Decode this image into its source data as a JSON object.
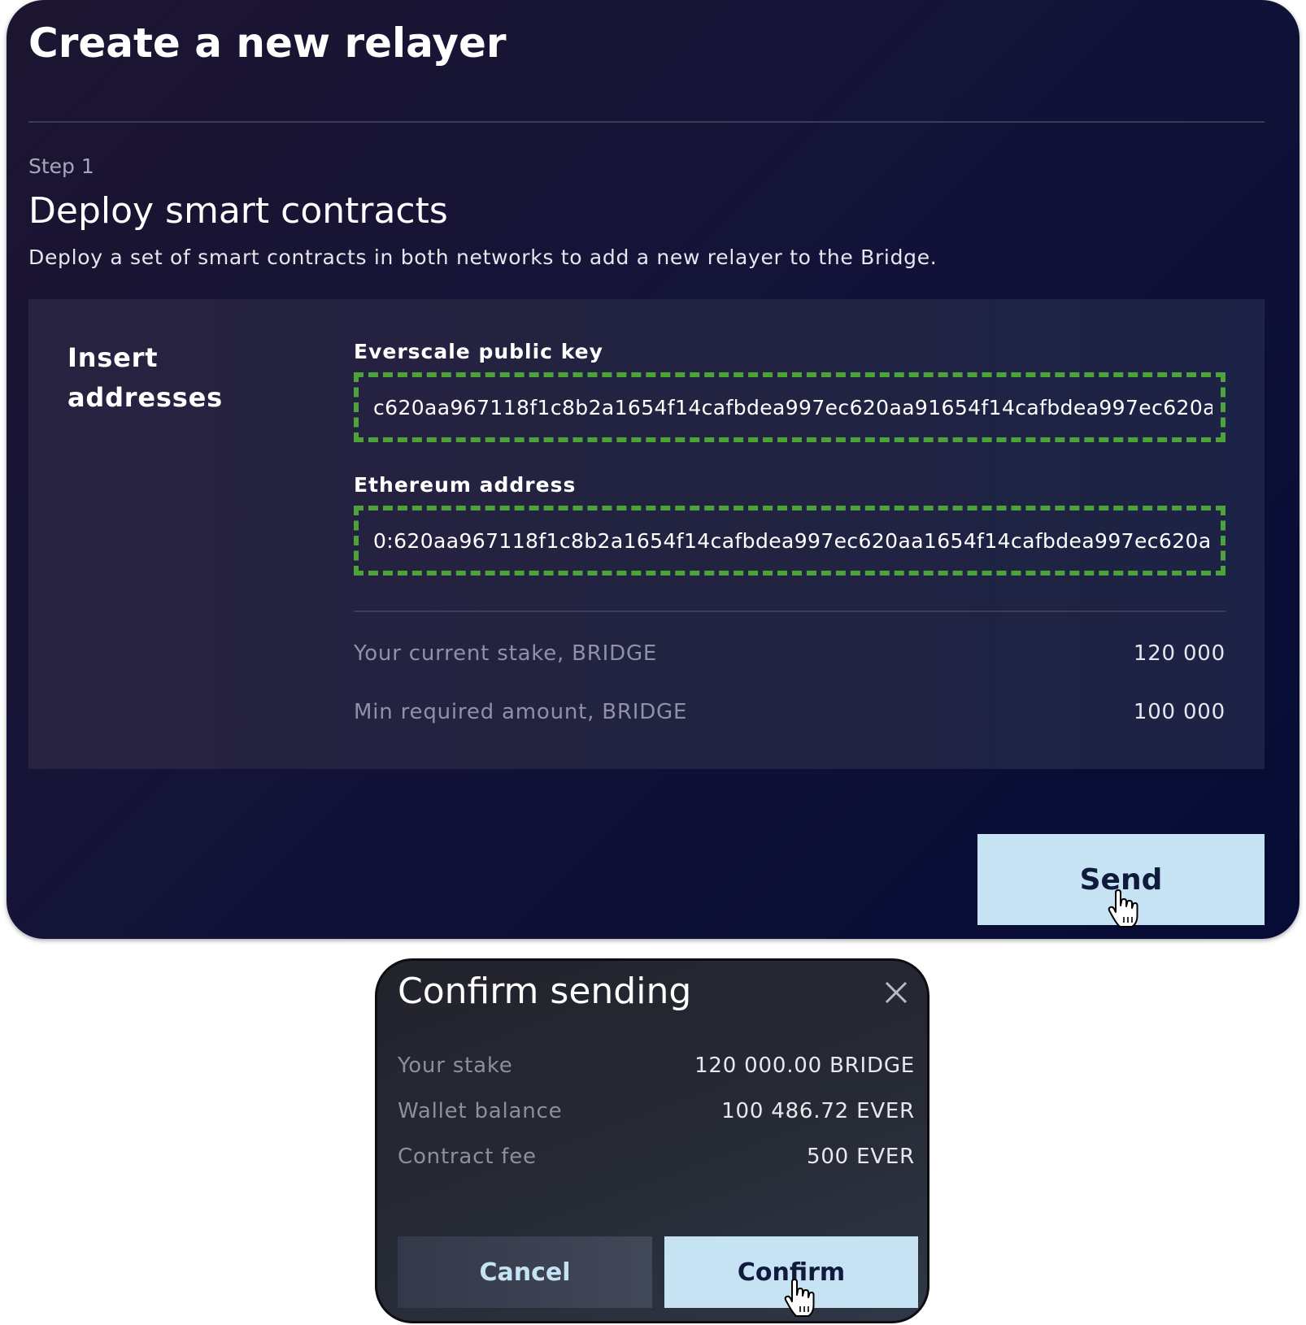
{
  "card": {
    "title": "Create a new relayer",
    "step": "Step 1",
    "subtitle": "Deploy smart contracts",
    "description": "Deploy a set of smart contracts in both networks to add a new relayer to the Bridge.",
    "panel": {
      "label": "Insert addresses",
      "everscale": {
        "label": "Everscale public key",
        "value": "c620aa967118f1c8b2a1654f14cafbdea997ec620aa91654f14cafbdea997ec620a"
      },
      "ethereum": {
        "label": "Ethereum address",
        "value": "0:620aa967118f1c8b2a1654f14cafbdea997ec620aa1654f14cafbdea997ec620a"
      },
      "stats": [
        {
          "label": "Your current stake, BRIDGE",
          "value": "120 000"
        },
        {
          "label": "Min required amount, BRIDGE",
          "value": "100 000"
        }
      ]
    },
    "send_label": "Send"
  },
  "modal": {
    "title": "Confirm sending",
    "rows": [
      {
        "label": "Your stake",
        "value": "120 000.00 BRIDGE"
      },
      {
        "label": "Wallet balance",
        "value": "100 486.72 EVER"
      },
      {
        "label": "Contract fee",
        "value": "500 EVER"
      }
    ],
    "cancel_label": "Cancel",
    "confirm_label": "Confirm"
  },
  "icons": {
    "close": "close-icon",
    "cursor": "hand-pointer-cursor-icon"
  },
  "colors": {
    "accent_button": "#c6e3f4",
    "dashed_border": "#4ea23a",
    "card_background": "#141338"
  }
}
